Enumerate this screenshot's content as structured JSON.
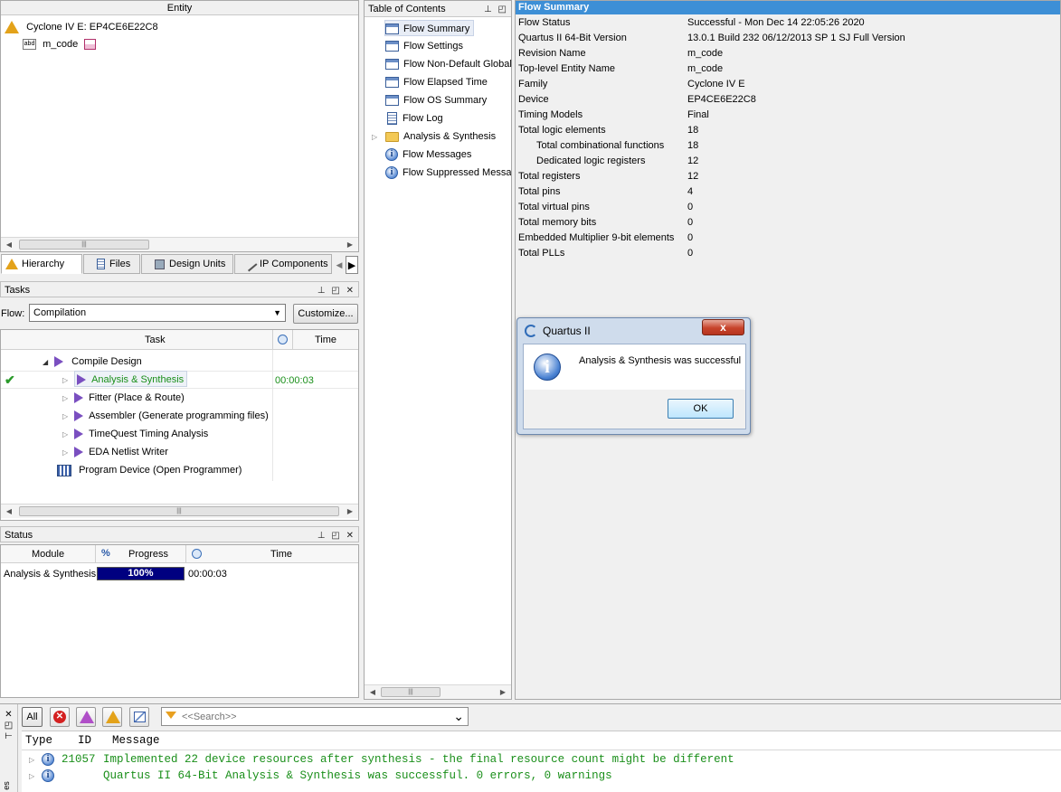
{
  "hierarchy": {
    "header": "Entity",
    "device": "Cyclone IV E: EP4CE6E22C8",
    "entity": "m_code",
    "tabs": [
      "Hierarchy",
      "Files",
      "Design Units",
      "IP Components"
    ]
  },
  "tasks": {
    "title": "Tasks",
    "flow_label": "Flow:",
    "flow_value": "Compilation",
    "customize_label": "Customize...",
    "col_task": "Task",
    "col_time": "Time",
    "rows": [
      {
        "label": "Compile Design",
        "time": ""
      },
      {
        "label": "Analysis & Synthesis",
        "time": "00:00:03"
      },
      {
        "label": "Fitter (Place & Route)",
        "time": ""
      },
      {
        "label": "Assembler (Generate programming files)",
        "time": ""
      },
      {
        "label": "TimeQuest Timing Analysis",
        "time": ""
      },
      {
        "label": "EDA Netlist Writer",
        "time": ""
      },
      {
        "label": "Program Device (Open Programmer)",
        "time": ""
      }
    ],
    "success_color": "#1a8f1a"
  },
  "status": {
    "title": "Status",
    "col_module": "Module",
    "col_pct": "%",
    "col_progress": "Progress",
    "col_time": "Time",
    "module": "Analysis & Synthesis",
    "progress_text": "100%",
    "progress_fraction": 1.0,
    "time": "00:00:03",
    "progress_color": "#000080"
  },
  "toc": {
    "title": "Table of Contents",
    "items": [
      {
        "label": "Flow Summary",
        "icon": "table-icon"
      },
      {
        "label": "Flow Settings",
        "icon": "table-icon"
      },
      {
        "label": "Flow Non-Default Global",
        "icon": "table-icon"
      },
      {
        "label": "Flow Elapsed Time",
        "icon": "table-icon"
      },
      {
        "label": "Flow OS Summary",
        "icon": "table-icon"
      },
      {
        "label": "Flow Log",
        "icon": "document-icon"
      },
      {
        "label": "Analysis & Synthesis",
        "icon": "folder-icon"
      },
      {
        "label": "Flow Messages",
        "icon": "info-icon"
      },
      {
        "label": "Flow Suppressed Messag",
        "icon": "info-icon"
      }
    ]
  },
  "flow_summary": {
    "title": "Flow Summary",
    "title_bg": "#3d8fd6",
    "rows": [
      {
        "key": "Flow Status",
        "value": "Successful - Mon Dec 14 22:05:26 2020",
        "indent": false
      },
      {
        "key": "Quartus II 64-Bit Version",
        "value": "13.0.1 Build 232 06/12/2013 SP 1 SJ Full Version",
        "indent": false
      },
      {
        "key": "Revision Name",
        "value": "m_code",
        "indent": false
      },
      {
        "key": "Top-level Entity Name",
        "value": "m_code",
        "indent": false
      },
      {
        "key": "Family",
        "value": "Cyclone IV E",
        "indent": false
      },
      {
        "key": "Device",
        "value": "EP4CE6E22C8",
        "indent": false
      },
      {
        "key": "Timing Models",
        "value": "Final",
        "indent": false
      },
      {
        "key": "Total logic elements",
        "value": "18",
        "indent": false
      },
      {
        "key": "Total combinational functions",
        "value": "18",
        "indent": true
      },
      {
        "key": "Dedicated logic registers",
        "value": "12",
        "indent": true
      },
      {
        "key": "Total registers",
        "value": "12",
        "indent": false
      },
      {
        "key": "Total pins",
        "value": "4",
        "indent": false
      },
      {
        "key": "Total virtual pins",
        "value": "0",
        "indent": false
      },
      {
        "key": "Total memory bits",
        "value": "0",
        "indent": false
      },
      {
        "key": "Embedded Multiplier 9-bit elements",
        "value": "0",
        "indent": false
      },
      {
        "key": "Total PLLs",
        "value": "0",
        "indent": false
      }
    ]
  },
  "dialog": {
    "title": "Quartus II",
    "message": "Analysis & Synthesis was successful",
    "ok_label": "OK",
    "close_label": "x"
  },
  "messages": {
    "all_label": "All",
    "search_placeholder": "<<Search>>",
    "col_type": "Type",
    "col_id": "ID",
    "col_message": "Message",
    "side_label": "es",
    "rows": [
      {
        "id": "21057",
        "text": "Implemented 22 device resources after synthesis - the final resource count might be different"
      },
      {
        "id": "",
        "text": "Quartus II 64-Bit Analysis & Synthesis was successful. 0 errors, 0 warnings"
      }
    ],
    "text_color": "#1a8f1a"
  }
}
